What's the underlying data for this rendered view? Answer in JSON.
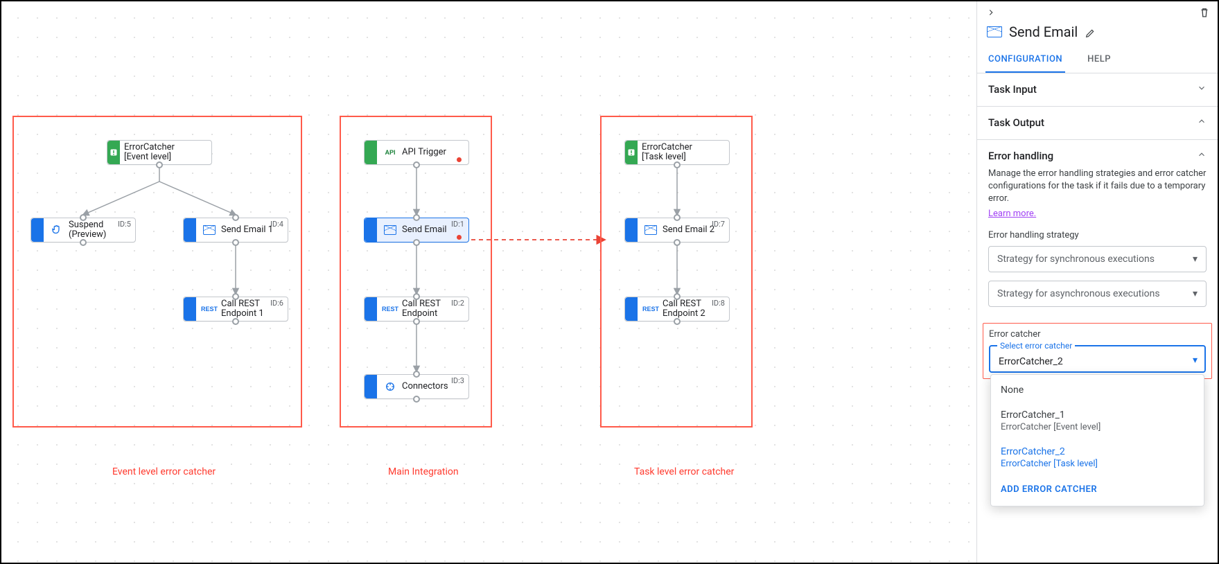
{
  "panel": {
    "title": "Send Email",
    "tabs": {
      "configuration": "CONFIGURATION",
      "help": "HELP"
    },
    "sections": {
      "task_input": {
        "title": "Task Input"
      },
      "task_output": {
        "title": "Task Output"
      },
      "error_handling": {
        "title": "Error handling",
        "description": "Manage the error handling strategies and error catcher configurations for the task if it fails due to a temporary error.",
        "learn_more": "Learn more.",
        "strategy_label": "Error handling strategy",
        "sync_placeholder": "Strategy for synchronous executions",
        "async_placeholder": "Strategy for asynchronous executions"
      }
    },
    "error_catcher": {
      "label": "Error catcher",
      "select_label": "Select error catcher",
      "value": "ErrorCatcher_2",
      "options": [
        {
          "name": "None"
        },
        {
          "name": "ErrorCatcher_1",
          "sub": "ErrorCatcher [Event level]"
        },
        {
          "name": "ErrorCatcher_2",
          "sub": "ErrorCatcher [Task level]",
          "selected": true
        }
      ],
      "add_label": "ADD ERROR CATCHER"
    }
  },
  "regions": {
    "event": {
      "label": "Event level error catcher"
    },
    "main": {
      "label": "Main Integration"
    },
    "task": {
      "label": "Task level error catcher"
    }
  },
  "nodes": {
    "error_event": {
      "label": "ErrorCatcher\n[Event level]"
    },
    "suspend": {
      "label": "Suspend\n(Preview)",
      "id": "ID:5"
    },
    "send_email_1": {
      "label": "Send Email 1",
      "id": "ID:4"
    },
    "rest_1": {
      "label": "Call REST\nEndpoint 1",
      "id": "ID:6"
    },
    "api_trigger": {
      "label": "API Trigger"
    },
    "send_email": {
      "label": "Send Email",
      "id": "ID:1"
    },
    "rest_main": {
      "label": "Call REST\nEndpoint",
      "id": "ID:2"
    },
    "connectors": {
      "label": "Connectors",
      "id": "ID:3"
    },
    "error_task": {
      "label": "ErrorCatcher\n[Task level]"
    },
    "send_email_2": {
      "label": "Send Email 2",
      "id": "ID:7"
    },
    "rest_2": {
      "label": "Call REST\nEndpoint 2",
      "id": "ID:8"
    }
  }
}
